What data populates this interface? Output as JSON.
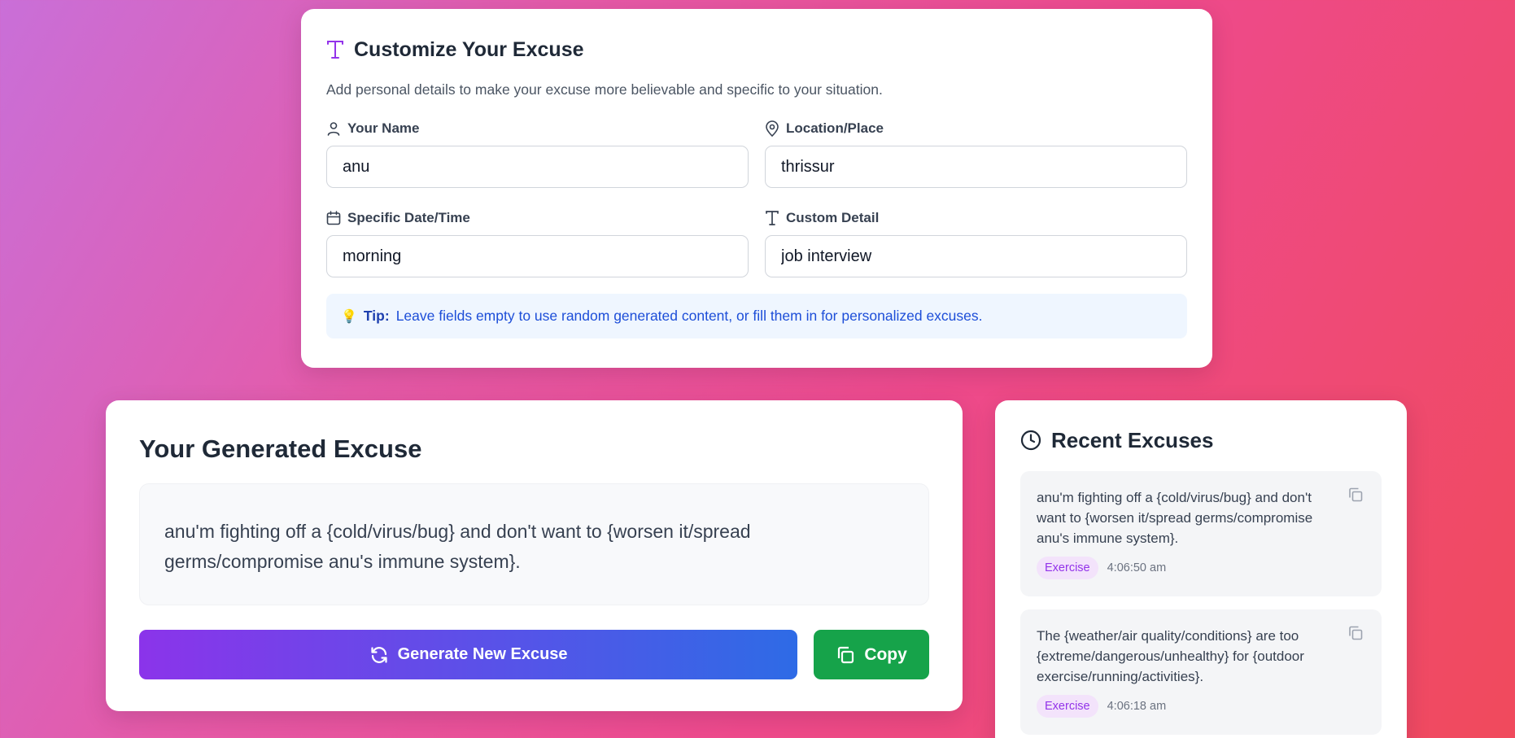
{
  "colors": {
    "accent_purple": "#9333ea",
    "tip_blue": "#1d4ed8",
    "copy_green": "#16a34a"
  },
  "customize": {
    "icon": "type-icon",
    "title": "Customize Your Excuse",
    "description": "Add personal details to make your excuse more believable and specific to your situation.",
    "fields": {
      "name": {
        "icon": "user-icon",
        "label": "Your Name",
        "value": "anu"
      },
      "location": {
        "icon": "map-pin-icon",
        "label": "Location/Place",
        "value": "thrissur"
      },
      "datetime": {
        "icon": "calendar-icon",
        "label": "Specific Date/Time",
        "value": "morning"
      },
      "custom": {
        "icon": "type-icon",
        "label": "Custom Detail",
        "value": "job interview"
      }
    },
    "tip": {
      "icon": "lightbulb-icon",
      "label": "Tip:",
      "text": "Leave fields empty to use random generated content, or fill them in for personalized excuses."
    }
  },
  "generated": {
    "title": "Your Generated Excuse",
    "excuse": "anu'm fighting off a {cold/virus/bug} and don't want to {worsen it/spread germs/compromise anu's immune system}.",
    "generate_button": {
      "icon": "refresh-icon",
      "label": "Generate New Excuse"
    },
    "copy_button": {
      "icon": "copy-icon",
      "label": "Copy"
    }
  },
  "recent": {
    "icon": "clock-icon",
    "title": "Recent Excuses",
    "items": [
      {
        "text": "anu'm fighting off a {cold/virus/bug} and don't want to {worsen it/spread germs/compromise anu's immune system}.",
        "category": "Exercise",
        "time": "4:06:50 am"
      },
      {
        "text": "The {weather/air quality/conditions} are too {extreme/dangerous/unhealthy} for {outdoor exercise/running/activities}.",
        "category": "Exercise",
        "time": "4:06:18 am"
      }
    ]
  }
}
